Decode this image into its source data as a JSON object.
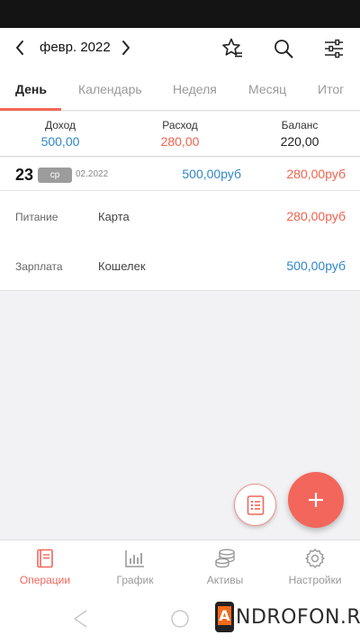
{
  "header": {
    "month_label": "февр. 2022"
  },
  "tabs": [
    {
      "label": "День",
      "active": true
    },
    {
      "label": "Календарь",
      "active": false
    },
    {
      "label": "Неделя",
      "active": false
    },
    {
      "label": "Месяц",
      "active": false
    },
    {
      "label": "Итог",
      "active": false
    }
  ],
  "summary": {
    "income_label": "Доход",
    "income_value": "500,00",
    "expense_label": "Расход",
    "expense_value": "280,00",
    "balance_label": "Баланс",
    "balance_value": "220,00"
  },
  "day": {
    "number": "23",
    "weekday": "ср",
    "month_year": "02.2022",
    "income": "500,00руб",
    "expense": "280,00руб"
  },
  "transactions": [
    {
      "category": "Питание",
      "account": "Карта",
      "amount": "280,00руб",
      "type": "expense"
    },
    {
      "category": "Зарплата",
      "account": "Кошелек",
      "amount": "500,00руб",
      "type": "income"
    }
  ],
  "bottom_nav": [
    {
      "label": "Операции",
      "icon": "book-icon",
      "active": true
    },
    {
      "label": "График",
      "icon": "bar-chart-icon",
      "active": false
    },
    {
      "label": "Активы",
      "icon": "coins-icon",
      "active": false
    },
    {
      "label": "Настройки",
      "icon": "gear-icon",
      "active": false
    }
  ],
  "watermark": {
    "letter": "A",
    "text": "NDROFON.RU"
  },
  "colors": {
    "accent": "#f2665b",
    "income": "#2f86c8",
    "expense": "#f0624d"
  }
}
